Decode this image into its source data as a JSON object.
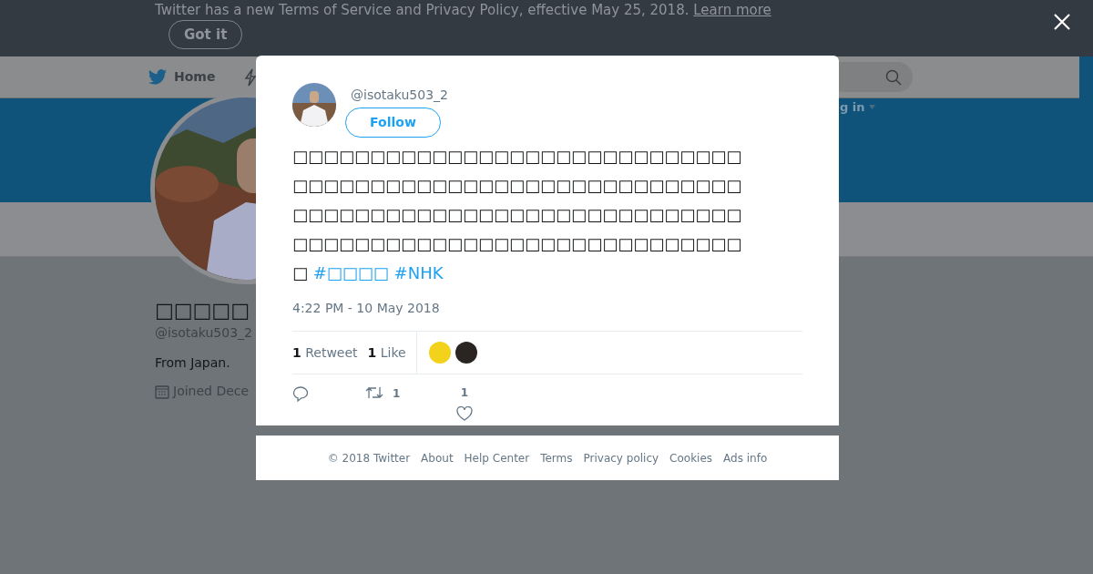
{
  "banner": {
    "message": "Twitter has a new Terms of Service and Privacy Policy, effective May 25, 2018.",
    "link": "Learn more",
    "button": "Got it"
  },
  "nav": {
    "home": "Home",
    "login_partial": "g in"
  },
  "profile": {
    "name": "□□□□□",
    "handle": "@isotaku503_2",
    "bio": "From Japan.",
    "joined": "Joined Dece"
  },
  "tweet": {
    "handle": "@isotaku503_2",
    "follow_button": "Follow",
    "text": "□□□□□□□□□□□□□□□□□□□□□□□□□□□□□□□□□□□□□□□□□□□□□□□□□□□□□□□□□□□□□□□□□□□□□□□□□□□□□□□□□□□□□□□□□□□□□□□□□□□□□□□□□□□□□□□□□□□□□",
    "hashtags": [
      "#□□□□",
      "#NHK"
    ],
    "timestamp": "4:22 PM - 10 May 2018",
    "stats": [
      {
        "count": "1",
        "label": "Retweet"
      },
      {
        "count": "1",
        "label": "Like"
      }
    ],
    "likers": [
      {
        "color": "#f2d21b"
      },
      {
        "color": "#2a2522"
      }
    ],
    "actions": [
      {
        "kind": "reply"
      },
      {
        "kind": "retweet",
        "count": "1"
      },
      {
        "kind": "like",
        "count": "1"
      }
    ]
  },
  "footer": [
    "© 2018 Twitter",
    "About",
    "Help Center",
    "Terms",
    "Privacy policy",
    "Cookies",
    "Ads info"
  ]
}
